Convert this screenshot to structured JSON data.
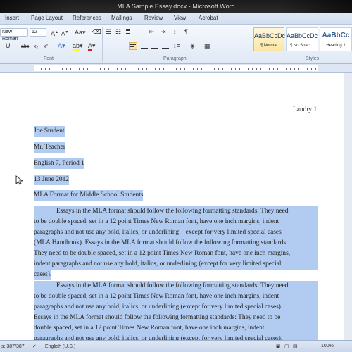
{
  "window": {
    "title": "MLA Sample Essay.docx - Microsoft Word"
  },
  "tabs": [
    "Insert",
    "Page Layout",
    "References",
    "Mailings",
    "Review",
    "View",
    "Acrobat"
  ],
  "ribbon": {
    "font_name": "New Roman",
    "font_size": "12",
    "groups": {
      "font": "Font",
      "paragraph": "Paragraph",
      "styles": "Styles"
    },
    "styles": [
      {
        "sample": "AaBbCcDc",
        "name": "¶ Normal",
        "selected": true
      },
      {
        "sample": "AaBbCcDc",
        "name": "¶ No Spaci...",
        "selected": false
      },
      {
        "sample": "AaBbCc",
        "name": "Heading 1",
        "selected": false
      }
    ]
  },
  "document": {
    "header": "Landry 1",
    "heading_lines": [
      "Joe Student",
      "Mr. Teacher",
      "English 7, Period 1",
      "13 June 2012",
      "MLA Format for Middle School Students"
    ],
    "paragraph1": [
      "Essays in the MLA format should follow the following formatting standards: They need",
      "to be double spaced, set in a 12 point Times  New Roman font, have one inch margins, indent",
      "paragraphs and not use any bold, italics, or underlining—except for very limited special  cases",
      "(MLA Handbook). Essays in the MLA format should follow the following formatting standards:",
      "They need to be double spaced, set in a 12 point Times  New Roman font, have one inch margins,",
      "indent paragraphs and not use any bold, italics, or underlining (except for very limited special",
      "cases)."
    ],
    "paragraph2": [
      "Essays in the MLA format should follow the following formatting standards: They need",
      "to be double spaced, set in a 12 point Times  New Roman font, have one inch margins, indent",
      "paragraphs and not use any bold, italics, or underlining (except for very limited special cases).",
      "Essays in the MLA format should follow the following formatting standards: They need to be",
      "double spaced, set in a 12 point Times  New Roman font, have one inch margins, indent",
      "paragraphs and not use any bold, italics, or underlining (except for very limited special cases)."
    ]
  },
  "status": {
    "words": "s: 387/387",
    "language": "English (U.S.)",
    "zoom": "100%"
  },
  "colors": {
    "selection": "#b1ccf0",
    "ribbon_bg": "#dfe8f5"
  }
}
